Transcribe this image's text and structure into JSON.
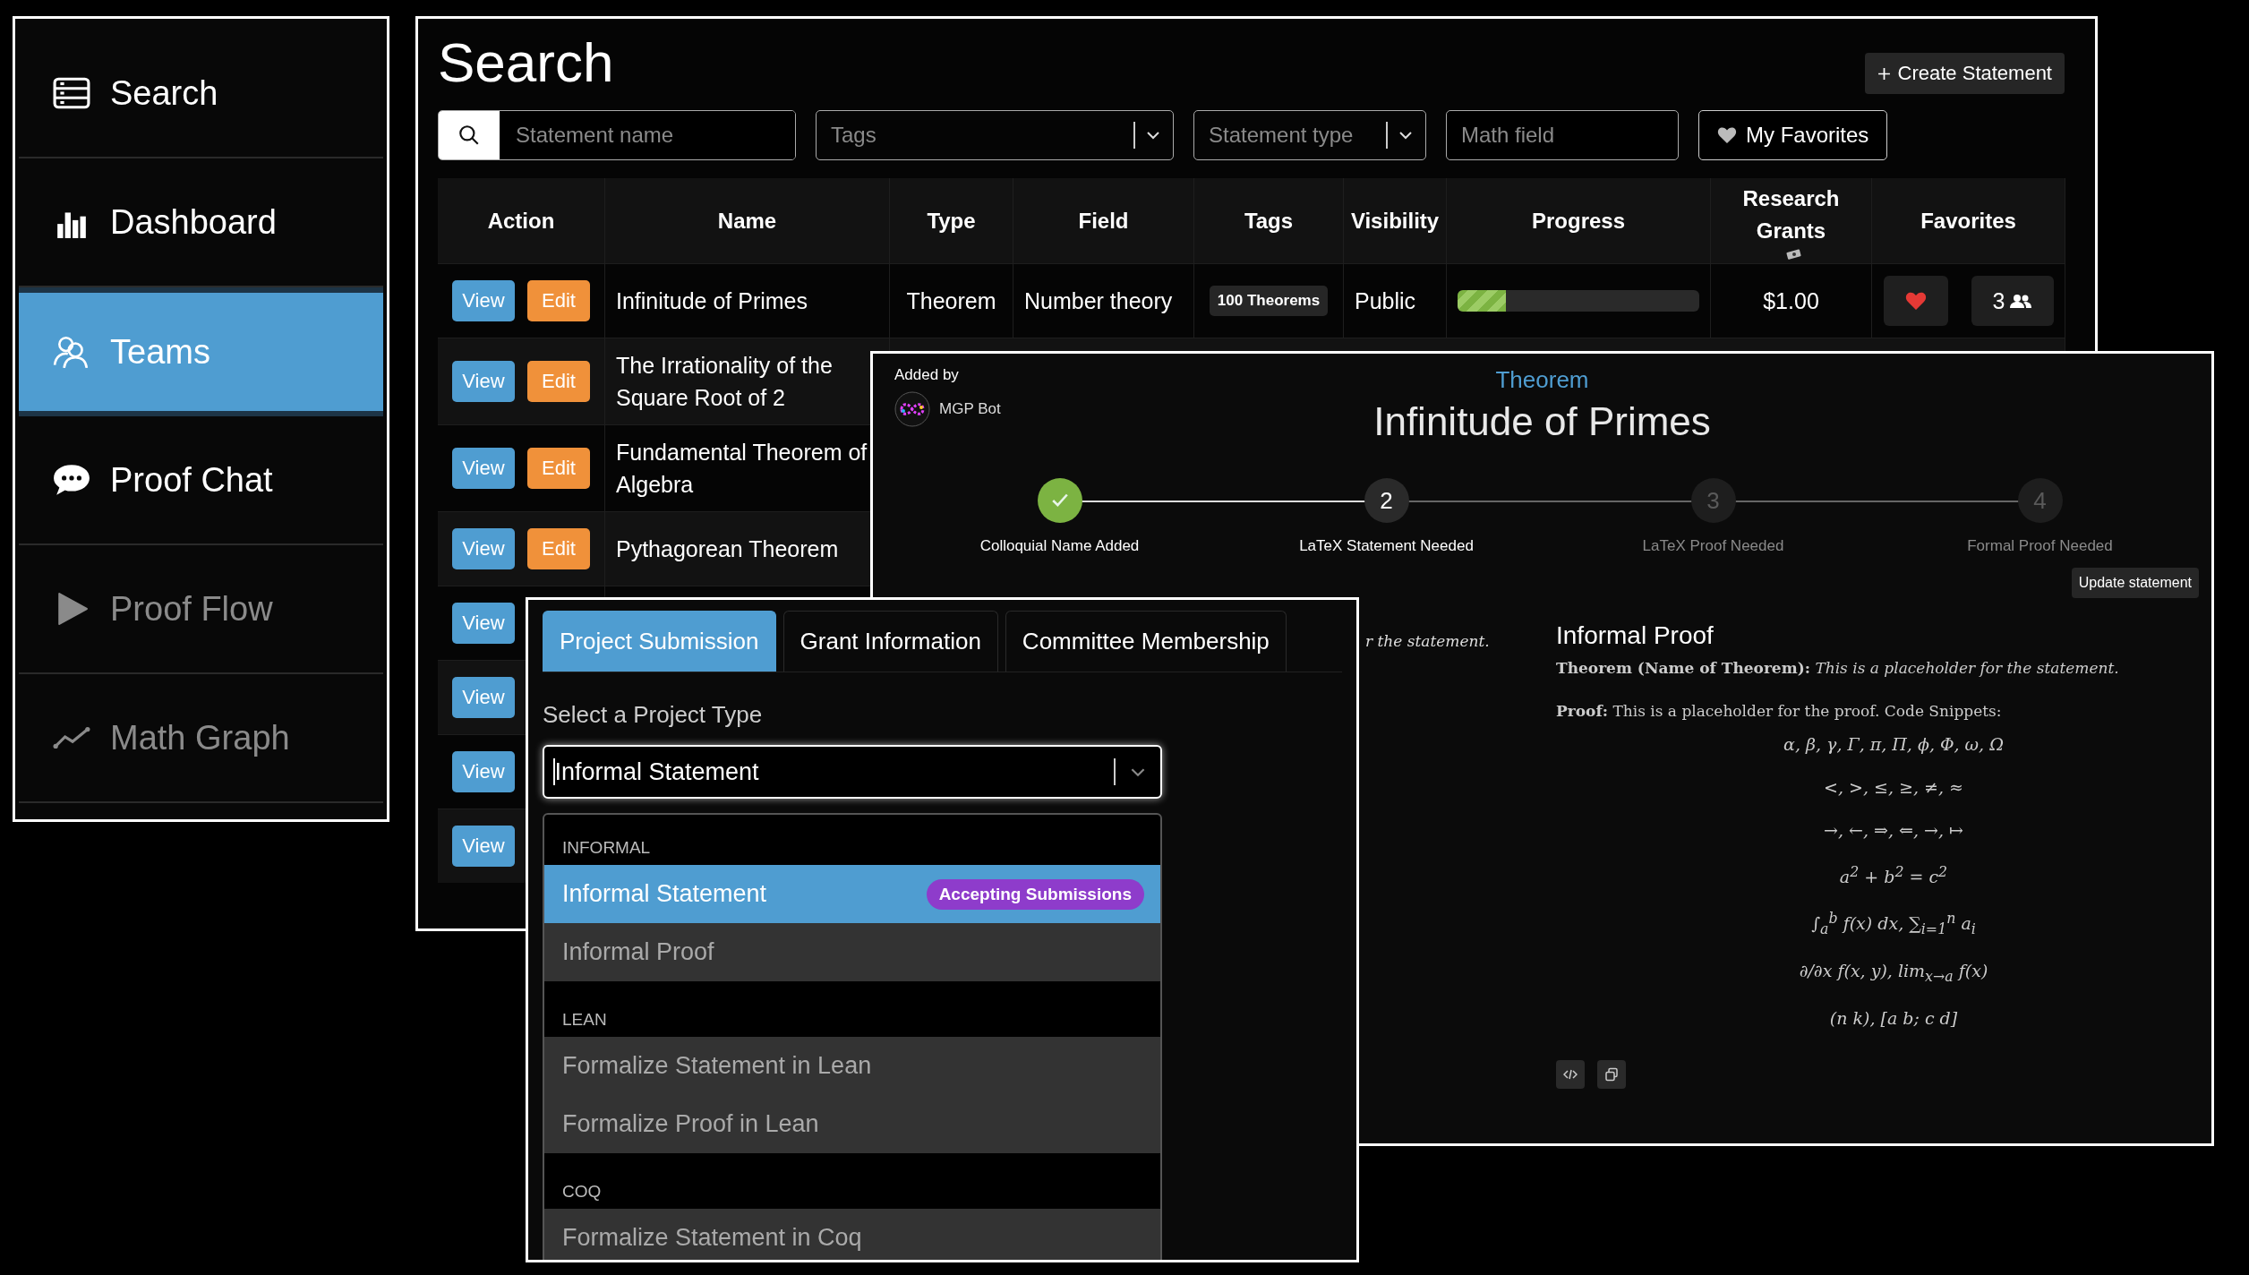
{
  "sidebar": {
    "items": [
      {
        "label": "Search",
        "selected": false,
        "disabled": false
      },
      {
        "label": "Dashboard",
        "selected": false,
        "disabled": false
      },
      {
        "label": "Teams",
        "selected": true,
        "disabled": false
      },
      {
        "label": "Proof Chat",
        "selected": false,
        "disabled": false
      },
      {
        "label": "Proof Flow",
        "selected": false,
        "disabled": true
      },
      {
        "label": "Math Graph",
        "selected": false,
        "disabled": true
      }
    ]
  },
  "search_page": {
    "title": "Search",
    "create_button": "Create Statement",
    "filters": {
      "name_placeholder": "Statement name",
      "tags_placeholder": "Tags",
      "type_placeholder": "Statement type",
      "field_placeholder": "Math field",
      "favorites_button": "My Favorites"
    },
    "table": {
      "columns": [
        "Action",
        "Name",
        "Type",
        "Field",
        "Tags",
        "Visibility",
        "Progress",
        "Research Grants",
        "Favorites"
      ],
      "rows": [
        {
          "actions": [
            "View",
            "Edit"
          ],
          "name": "Infinitude of Primes",
          "type": "Theorem",
          "field": "Number theory",
          "tag": "100 Theorems",
          "visibility": "Public",
          "level": 0.2,
          "grants": "$1.00",
          "favorite": true,
          "followers": "3"
        },
        {
          "actions": [
            "View",
            "Edit"
          ],
          "name": "The Irrationality of the Square Root of 2"
        },
        {
          "actions": [
            "View",
            "Edit"
          ],
          "name": "Fundamental Theorem of Algebra"
        },
        {
          "actions": [
            "View",
            "Edit"
          ],
          "name": "Pythagorean Theorem"
        },
        {
          "actions": [
            "View"
          ]
        },
        {
          "actions": [
            "View"
          ]
        },
        {
          "actions": [
            "View"
          ]
        },
        {
          "actions": [
            "View"
          ]
        }
      ]
    }
  },
  "statement_panel": {
    "added_by_label": "Added by",
    "author": "MGP Bot",
    "kind_label": "Theorem",
    "title": "Infinitude of Primes",
    "steps": [
      {
        "label": "Colloquial Name Added",
        "completed": true,
        "active": false
      },
      {
        "number": "2",
        "label": "LaTeX Statement Needed",
        "completed": false,
        "active": true
      },
      {
        "number": "3",
        "label": "LaTeX Proof Needed",
        "completed": false,
        "active": false
      },
      {
        "number": "4",
        "label": "Formal Proof Needed",
        "completed": false,
        "active": false
      }
    ],
    "update_button": "Update statement",
    "fragment": "r the statement.",
    "section_title": "Informal Proof",
    "theorem": "**Theorem (Name of Theorem):** *This is a placeholder for the statement.*",
    "proof": "**Proof:** This is a placeholder for the proof. Code Snippets:",
    "formulas": [
      "α, β, γ, Γ, π, Π, ϕ, Φ, ω, Ω",
      "<, >, ≤, ≥, ≠, ≈",
      "→, ←, ⇒, ⇐, →, ↦",
      "a$^{2}$ + b$^{2}$ = c$^{2}$",
      "∫$_{a}$$^{b}$ f(x) dx, ∑$_{i=1}$$^{n}$ a$_{i}$",
      "∂/∂x f(x, y), lim$_{x→a}$ f(x)",
      "(n k), [a b; c d]"
    ]
  },
  "submission_panel": {
    "tabs": [
      {
        "label": "Project Submission",
        "selected": true
      },
      {
        "label": "Grant Information",
        "selected": false
      },
      {
        "label": "Committee Membership",
        "selected": false
      }
    ],
    "select_label": "Select a Project Type",
    "select_value": "Informal Statement",
    "groups": [
      {
        "label": "INFORMAL",
        "options": [
          {
            "label": "Informal Statement",
            "selected": true,
            "badge": "Accepting Submissions"
          },
          {
            "label": "Informal Proof",
            "selected": false
          }
        ]
      },
      {
        "label": "LEAN",
        "options": [
          {
            "label": "Formalize Statement in Lean",
            "selected": false
          },
          {
            "label": "Formalize Proof in Lean",
            "selected": false
          }
        ]
      },
      {
        "label": "COQ",
        "options": [
          {
            "label": "Formalize Statement in Coq",
            "selected": false
          }
        ]
      }
    ]
  }
}
